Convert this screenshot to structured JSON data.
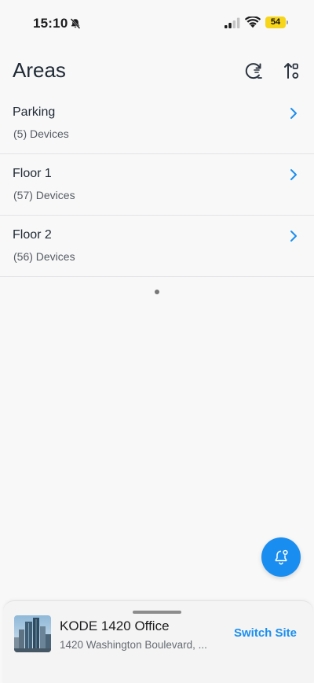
{
  "status_bar": {
    "time": "15:10",
    "battery": "54",
    "icons": [
      "bell-slash-icon",
      "cellular-signal-icon",
      "wifi-icon",
      "battery-icon"
    ]
  },
  "header": {
    "title": "Areas",
    "actions": [
      "refresh-icon",
      "sort-icon"
    ]
  },
  "areas": [
    {
      "name": "Parking",
      "devices": "(5) Devices"
    },
    {
      "name": "Floor 1",
      "devices": "(57) Devices"
    },
    {
      "name": "Floor 2",
      "devices": "(56) Devices"
    }
  ],
  "fab": {
    "icon": "notification-bell-icon"
  },
  "site": {
    "name": "KODE 1420 Office",
    "address": "1420 Washington Boulevard, ...",
    "switch_label": "Switch Site"
  },
  "colors": {
    "accent": "#1a8ef0",
    "background": "#f8f8f8",
    "battery": "#f7d51a",
    "title": "#202a36"
  }
}
